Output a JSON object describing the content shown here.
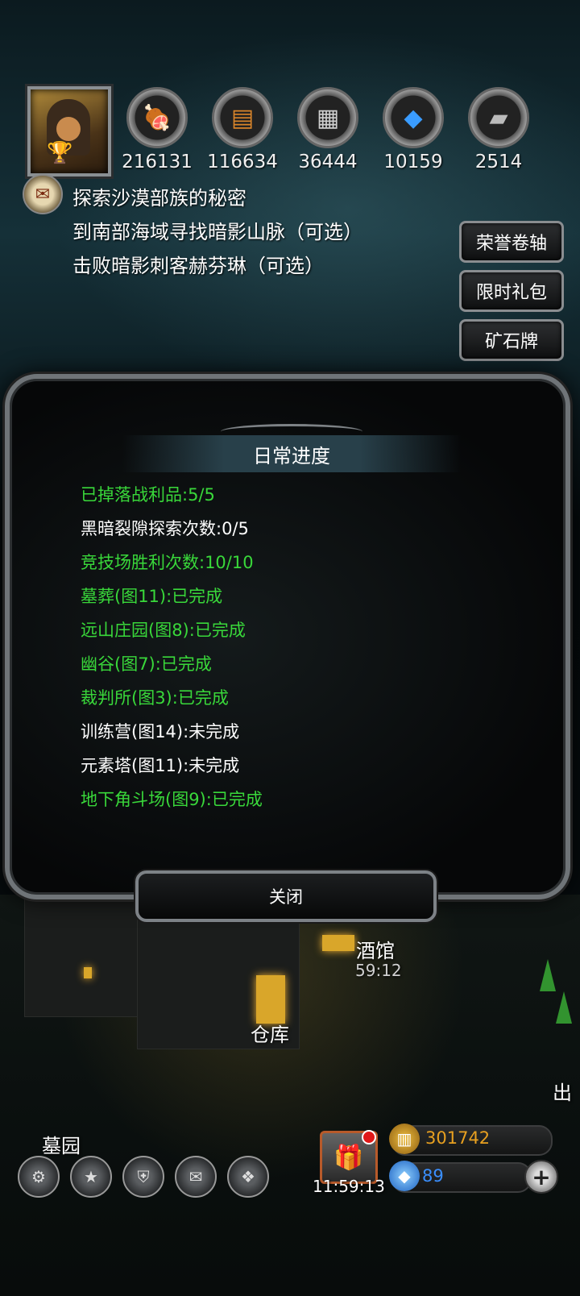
{
  "resources": [
    {
      "icon": "meat-icon",
      "value": "216131"
    },
    {
      "icon": "wood-icon",
      "value": "116634"
    },
    {
      "icon": "iron-icon",
      "value": "36444"
    },
    {
      "icon": "crystal-icon",
      "value": "10159"
    },
    {
      "icon": "ingot-icon",
      "value": "2514"
    }
  ],
  "quests": [
    "探索沙漠部族的秘密",
    "到南部海域寻找暗影山脉（可选）",
    "击败暗影刺客赫芬琳（可选）"
  ],
  "side_buttons": [
    "荣誉卷轴",
    "限时礼包",
    "矿石牌"
  ],
  "dialog": {
    "title": "日常进度",
    "items": [
      {
        "text": "已掉落战利品:5/5",
        "done": true
      },
      {
        "text": "黑暗裂隙探索次数:0/5",
        "done": false
      },
      {
        "text": "竞技场胜利次数:10/10",
        "done": true
      },
      {
        "text": "墓葬(图11):已完成",
        "done": true
      },
      {
        "text": "远山庄园(图8):已完成",
        "done": true
      },
      {
        "text": "幽谷(图7):已完成",
        "done": true
      },
      {
        "text": "裁判所(图3):已完成",
        "done": true
      },
      {
        "text": "训练营(图14):未完成",
        "done": false
      },
      {
        "text": "元素塔(图11):未完成",
        "done": false
      },
      {
        "text": "地下角斗场(图9):已完成",
        "done": true
      }
    ],
    "close_label": "关闭"
  },
  "town": {
    "tavern": "酒馆",
    "tavern_timer": "59:12",
    "warehouse": "仓库",
    "graveyard": "墓园",
    "exit_partial": "出"
  },
  "bottom": {
    "gift_timer": "11:59:13",
    "gold": "301742",
    "gems": "89"
  },
  "colors": {
    "done": "#39d83a",
    "todo": "#ffffff",
    "gold_text": "#e8a020",
    "gem_text": "#3a8fff"
  }
}
